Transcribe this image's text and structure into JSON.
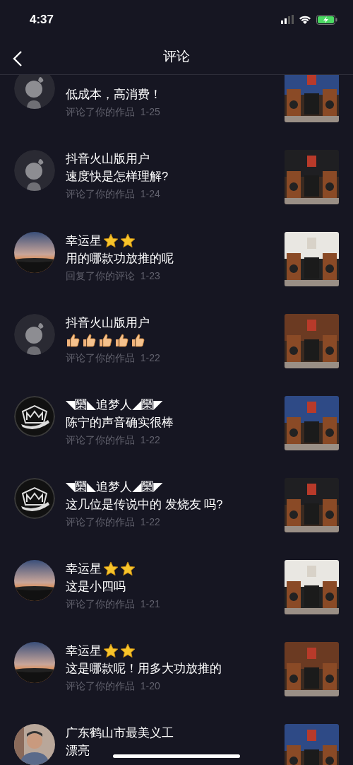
{
  "status_bar": {
    "time": "4:37"
  },
  "nav": {
    "title": "评论"
  },
  "items": [
    {
      "avatar": {
        "kind": "default"
      },
      "comment": "低成本，高消费！",
      "meta": "评论了你的作品  1-25"
    },
    {
      "avatar": {
        "kind": "default"
      },
      "name": "抖音火山版用户",
      "comment": "速度快是怎样理解?",
      "meta": "评论了你的作品  1-24"
    },
    {
      "avatar": {
        "kind": "sunset"
      },
      "name": "幸运星",
      "name_icons": [
        {
          "kind": "star"
        },
        {
          "kind": "star"
        }
      ],
      "comment": "用的哪款功放推的呢",
      "meta": "回复了你的评论  1-23"
    },
    {
      "avatar": {
        "kind": "default"
      },
      "name": "抖音火山版用户",
      "comment_icons": [
        {
          "kind": "thumbs-up"
        },
        {
          "kind": "thumbs-up"
        },
        {
          "kind": "thumbs-up"
        },
        {
          "kind": "thumbs-up"
        },
        {
          "kind": "thumbs-up"
        }
      ],
      "meta": "评论了你的作品  1-22"
    },
    {
      "avatar": {
        "kind": "emblem"
      },
      "name": "◥圞◣追梦人◢圞◤",
      "comment": "陈宁的声音确实很棒",
      "meta": "评论了你的作品  1-22"
    },
    {
      "avatar": {
        "kind": "emblem"
      },
      "name": "◥圞◣追梦人◢圞◤",
      "comment": "这几位是传说中的 发烧友 吗?",
      "meta": "评论了你的作品  1-22"
    },
    {
      "avatar": {
        "kind": "sunset"
      },
      "name": "幸运星",
      "name_icons": [
        {
          "kind": "star"
        },
        {
          "kind": "star"
        }
      ],
      "comment": "这是小四吗",
      "meta": "评论了你的作品  1-21"
    },
    {
      "avatar": {
        "kind": "sunset"
      },
      "name": "幸运星",
      "name_icons": [
        {
          "kind": "star"
        },
        {
          "kind": "star"
        }
      ],
      "comment": "这是哪款呢！用多大功放推的",
      "meta": "评论了你的作品  1-20"
    },
    {
      "avatar": {
        "kind": "person"
      },
      "name": "广东鹤山市最美义工",
      "comment": "漂亮"
    }
  ]
}
